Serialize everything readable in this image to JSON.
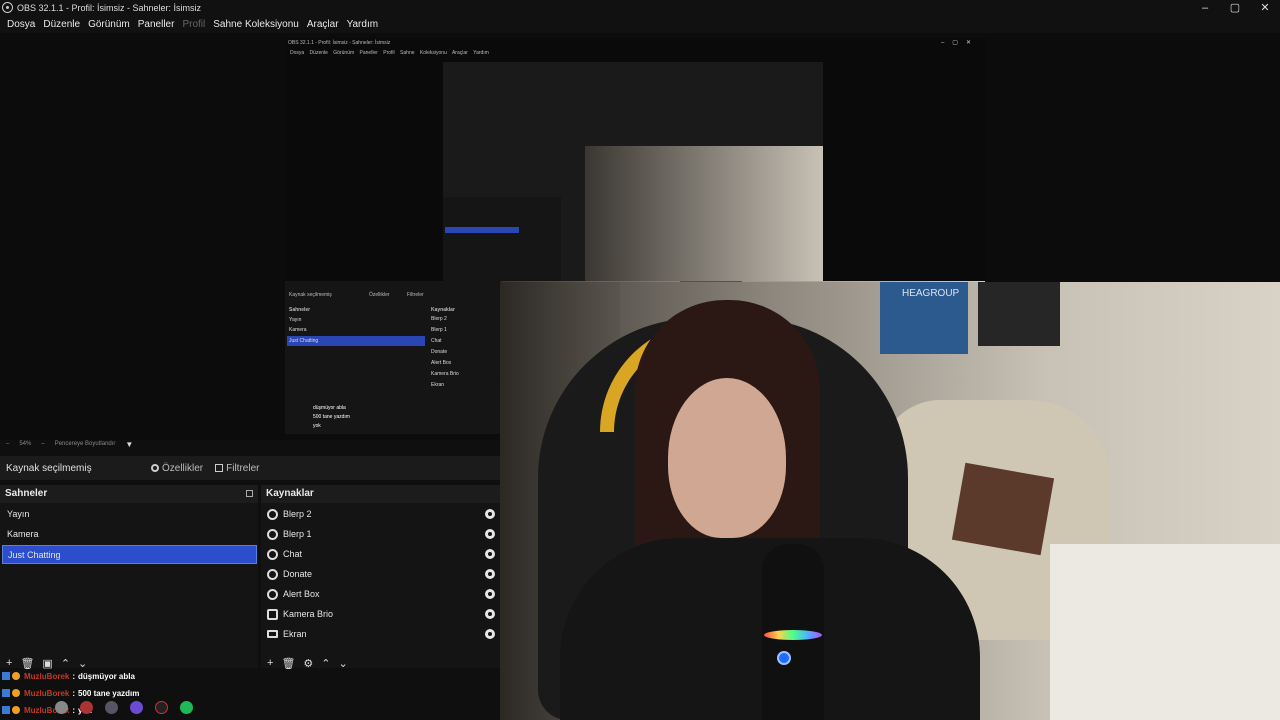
{
  "window": {
    "title": "OBS 32.1.1 - Profil: İsimsiz - Sahneler: İsimsiz",
    "controls": [
      "–",
      "▢",
      "✕"
    ]
  },
  "menu": [
    "Dosya",
    "Düzenle",
    "Görünüm",
    "Paneller",
    "Profil",
    "Sahne Koleksiyonu",
    "Araçlar",
    "Yardım"
  ],
  "nested": {
    "title": "OBS 32.1.1 - Profil: İsimsiz - Sahneler: İsimsiz",
    "menu": "Dosya Düzenle Görünüm Paneller Profil Sahne Koleksiyonu Araçlar Yardım",
    "source_label": "Kaynak seçilmemiş",
    "properties": "Özellikler",
    "filters": "Filtreler",
    "scenes_header": "Sahneler",
    "sources_header": "Kaynaklar",
    "scenes": [
      "Yayın",
      "Kamera",
      "Just Chatting"
    ],
    "sources": [
      "Blerp 2",
      "Blerp 1",
      "Chat",
      "Donate",
      "Alert Box",
      "Kamera Brio",
      "Ekran"
    ],
    "chat1": "düşmüyor abla",
    "chat2": "500 tane yazdım",
    "chat3": "yok"
  },
  "zoom": {
    "value": "54%",
    "label": "Pencereye Boyutlandır"
  },
  "video": {
    "towel_text": "HEAGROUP"
  },
  "source_toolbar": {
    "label": "Kaynak seçilmemiş",
    "properties": "Özellikler",
    "filters": "Filtreler"
  },
  "scenes": {
    "header": "Sahneler",
    "items": [
      "Yayın",
      "Kamera",
      "Just Chatting"
    ],
    "selected": "Just Chatting"
  },
  "sources": {
    "header": "Kaynaklar",
    "items": [
      {
        "label": "Blerp 2",
        "icon": "browser-icon"
      },
      {
        "label": "Blerp 1",
        "icon": "browser-icon"
      },
      {
        "label": "Chat",
        "icon": "browser-icon"
      },
      {
        "label": "Donate",
        "icon": "browser-icon"
      },
      {
        "label": "Alert Box",
        "icon": "browser-icon"
      },
      {
        "label": "Kamera Brio",
        "icon": "camera-icon"
      },
      {
        "label": "Ekran",
        "icon": "monitor-icon"
      }
    ]
  },
  "dock_tools": [
    "+",
    "🗑",
    "▣",
    "⌃",
    "⌄"
  ],
  "source_tools": [
    "+",
    "🗑",
    "⚙",
    "⌃",
    "⌄"
  ],
  "chat": [
    {
      "user": "MuzluBorek",
      "message": "düşmüyor abla"
    },
    {
      "user": "MuzluBorek",
      "message": "500 tane yazdım"
    },
    {
      "user": "MuzluBorek",
      "message": "yok"
    }
  ],
  "colors": {
    "selected": "#2c4ecc",
    "chair": "#d8a623",
    "username": "#c0392b"
  }
}
